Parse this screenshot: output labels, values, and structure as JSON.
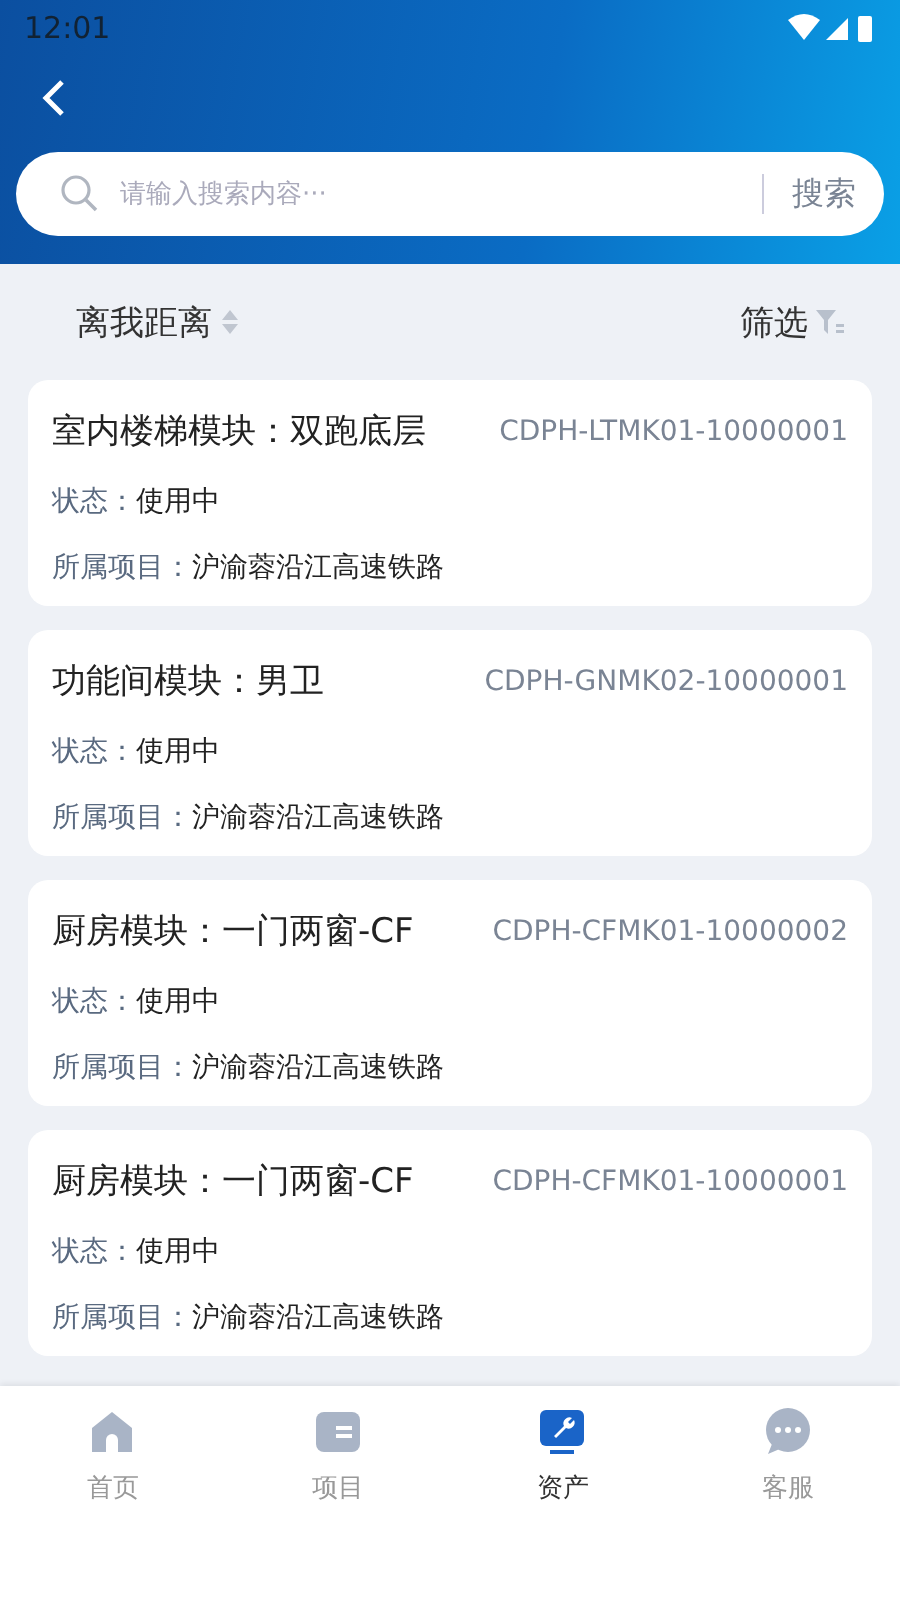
{
  "status_bar": {
    "time": "12:01"
  },
  "search": {
    "placeholder": "请输入搜索内容···",
    "button": "搜索"
  },
  "toolbar": {
    "sort": "离我距离",
    "filter": "筛选"
  },
  "cards": [
    {
      "title": "室内楼梯模块：双跑底层",
      "code": "CDPH-LTMK01-10000001",
      "fields": [
        {
          "label": "状态：",
          "value": "使用中"
        },
        {
          "label": "所属项目：",
          "value": "沪渝蓉沿江高速铁路"
        }
      ]
    },
    {
      "title": "功能间模块：男卫",
      "code": "CDPH-GNMK02-10000001",
      "fields": [
        {
          "label": "状态：",
          "value": "使用中"
        },
        {
          "label": "所属项目：",
          "value": "沪渝蓉沿江高速铁路"
        }
      ]
    },
    {
      "title": "厨房模块：一门两窗-CF",
      "code": "CDPH-CFMK01-10000002",
      "fields": [
        {
          "label": "状态：",
          "value": "使用中"
        },
        {
          "label": "所属项目：",
          "value": "沪渝蓉沿江高速铁路"
        }
      ]
    },
    {
      "title": "厨房模块：一门两窗-CF",
      "code": "CDPH-CFMK01-10000001",
      "fields": [
        {
          "label": "状态：",
          "value": "使用中"
        },
        {
          "label": "所属项目：",
          "value": "沪渝蓉沿江高速铁路"
        }
      ]
    }
  ],
  "tabs": [
    {
      "kind": "home",
      "label": "首页",
      "selected": false
    },
    {
      "kind": "folder",
      "label": "项目",
      "selected": false
    },
    {
      "kind": "tool",
      "label": "资产",
      "selected": true
    },
    {
      "kind": "chat",
      "label": "客服",
      "selected": false
    }
  ]
}
